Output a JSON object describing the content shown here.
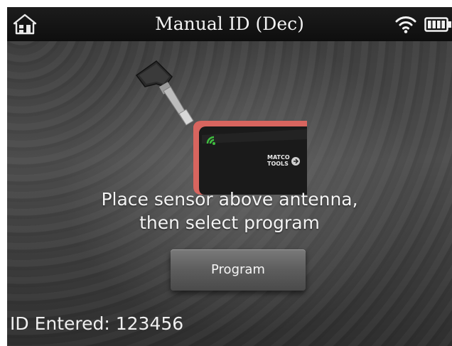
{
  "status_bar": {
    "title": "Manual ID (Dec)",
    "home_icon": "home-icon",
    "wifi_icon": "wifi-icon",
    "battery_icon": "battery-icon"
  },
  "illustration": {
    "brand_text": "MATCO TOOLS"
  },
  "instruction": {
    "line1": "Place sensor above antenna,",
    "line2": "then select program"
  },
  "program_button": {
    "label": "Program"
  },
  "id_entered": {
    "text": "ID Entered: 123456"
  },
  "colors": {
    "status_bar": "#111111",
    "background": "#444444",
    "tool_accent": "#e0706a",
    "antenna_green": "#3fbf3f"
  }
}
